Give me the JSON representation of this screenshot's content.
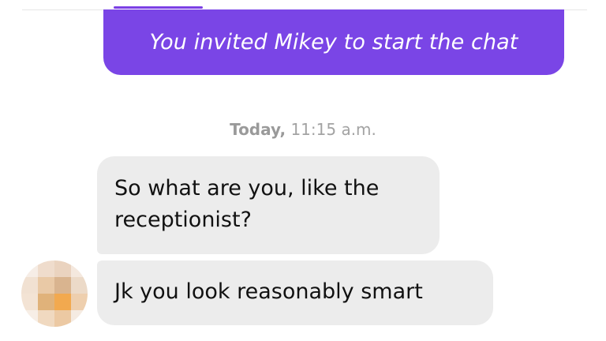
{
  "invite_banner": {
    "text": "You invited Mikey to start the chat"
  },
  "timestamp": {
    "day": "Today,",
    "time": "11:15 a.m."
  },
  "messages": [
    {
      "text": "So what are you, like the receptionist?"
    },
    {
      "text": "Jk you look reasonably smart"
    }
  ],
  "colors": {
    "accent": "#7a45e6",
    "incoming_bubble": "#ececec",
    "timestamp": "#a3a3a3"
  },
  "avatar": {
    "icon": "blurred-profile-avatar",
    "pixels": [
      "#f6ede6",
      "#efdccc",
      "#ead3bf",
      "#f4e8de",
      "#f1e1d2",
      "#e9c9a6",
      "#d9b48f",
      "#ecdac8",
      "#f3e3d4",
      "#e0b27a",
      "#f2a94f",
      "#eecfae",
      "#f7eee6",
      "#f0d9c0",
      "#ecc9a3",
      "#f5ebe2"
    ]
  }
}
